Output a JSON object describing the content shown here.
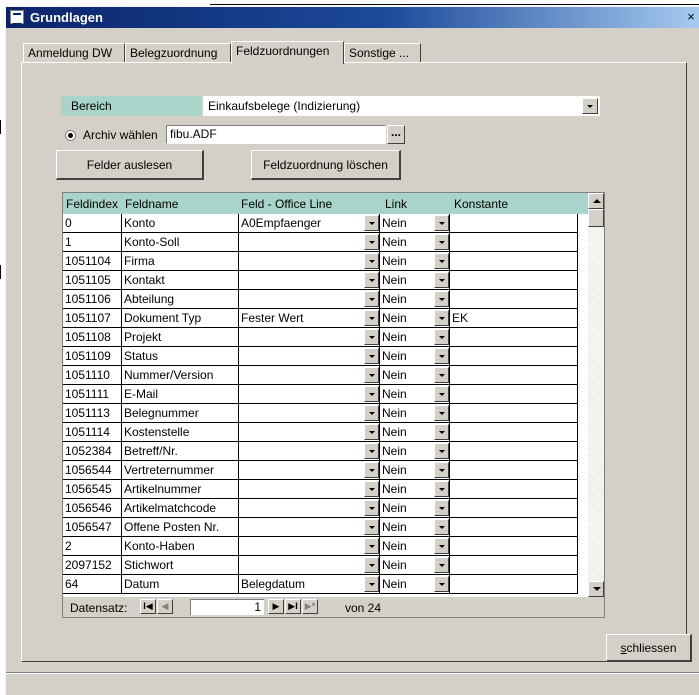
{
  "window": {
    "title": "Grundlagen",
    "close_glyph": "×"
  },
  "tabs": [
    {
      "label": "Anmeldung DW",
      "active": false
    },
    {
      "label": "Belegzuordnung",
      "active": false
    },
    {
      "label": "Feldzuordnungen",
      "active": true
    },
    {
      "label": "Sonstige ...",
      "active": false
    }
  ],
  "form": {
    "bereich_label": "Bereich",
    "bereich_value": "Einkaufsbelege  (Indizierung)",
    "archiv_label": "Archiv wählen",
    "archiv_value": "fibu.ADF",
    "browse_label": "...",
    "btn_felder_auslesen": "Felder auslesen",
    "btn_feldzuordnung_loeschen": "Feldzuordnung löschen"
  },
  "grid": {
    "columns": [
      "Feldindex",
      "Feldname",
      "Feld - Office Line",
      "Link",
      "Konstante"
    ],
    "rows": [
      {
        "index": "0",
        "name": "Konto",
        "office": "A0Empfaenger",
        "link": "Nein",
        "konst": ""
      },
      {
        "index": "1",
        "name": "Konto-Soll",
        "office": "",
        "link": "Nein",
        "konst": ""
      },
      {
        "index": "1051104",
        "name": "Firma",
        "office": "",
        "link": "Nein",
        "konst": ""
      },
      {
        "index": "1051105",
        "name": "Kontakt",
        "office": "",
        "link": "Nein",
        "konst": ""
      },
      {
        "index": "1051106",
        "name": "Abteilung",
        "office": "",
        "link": "Nein",
        "konst": ""
      },
      {
        "index": "1051107",
        "name": "Dokument Typ",
        "office": "Fester Wert",
        "link": "Nein",
        "konst": "EK"
      },
      {
        "index": "1051108",
        "name": "Projekt",
        "office": "",
        "link": "Nein",
        "konst": ""
      },
      {
        "index": "1051109",
        "name": "Status",
        "office": "",
        "link": "Nein",
        "konst": ""
      },
      {
        "index": "1051110",
        "name": "Nummer/Version",
        "office": "",
        "link": "Nein",
        "konst": ""
      },
      {
        "index": "1051111",
        "name": "E-Mail",
        "office": "",
        "link": "Nein",
        "konst": ""
      },
      {
        "index": "1051113",
        "name": "Belegnummer",
        "office": "",
        "link": "Nein",
        "konst": ""
      },
      {
        "index": "1051114",
        "name": "Kostenstelle",
        "office": "",
        "link": "Nein",
        "konst": ""
      },
      {
        "index": "1052384",
        "name": "Betreff/Nr.",
        "office": "",
        "link": "Nein",
        "konst": ""
      },
      {
        "index": "1056544",
        "name": "Vertreternummer",
        "office": "",
        "link": "Nein",
        "konst": ""
      },
      {
        "index": "1056545",
        "name": "Artikelnummer",
        "office": "",
        "link": "Nein",
        "konst": ""
      },
      {
        "index": "1056546",
        "name": "Artikelmatchcode",
        "office": "",
        "link": "Nein",
        "konst": ""
      },
      {
        "index": "1056547",
        "name": "Offene Posten Nr.",
        "office": "",
        "link": "Nein",
        "konst": ""
      },
      {
        "index": "2",
        "name": "Konto-Haben",
        "office": "",
        "link": "Nein",
        "konst": ""
      },
      {
        "index": "2097152",
        "name": "Stichwort",
        "office": "",
        "link": "Nein",
        "konst": ""
      },
      {
        "index": "64",
        "name": "Datum",
        "office": "Belegdatum",
        "link": "Nein",
        "konst": ""
      }
    ]
  },
  "navigation": {
    "label": "Datensatz:",
    "first": "I◀",
    "prev": "◀",
    "current": "1",
    "next": "▶",
    "last": "▶I",
    "new": "▶*",
    "of_text": "von 24"
  },
  "footer": {
    "close_label": "schliessen"
  },
  "colors": {
    "title_bar": "#0a246a",
    "header_teal": "#a8d4c9",
    "face": "#d4d0c8"
  }
}
